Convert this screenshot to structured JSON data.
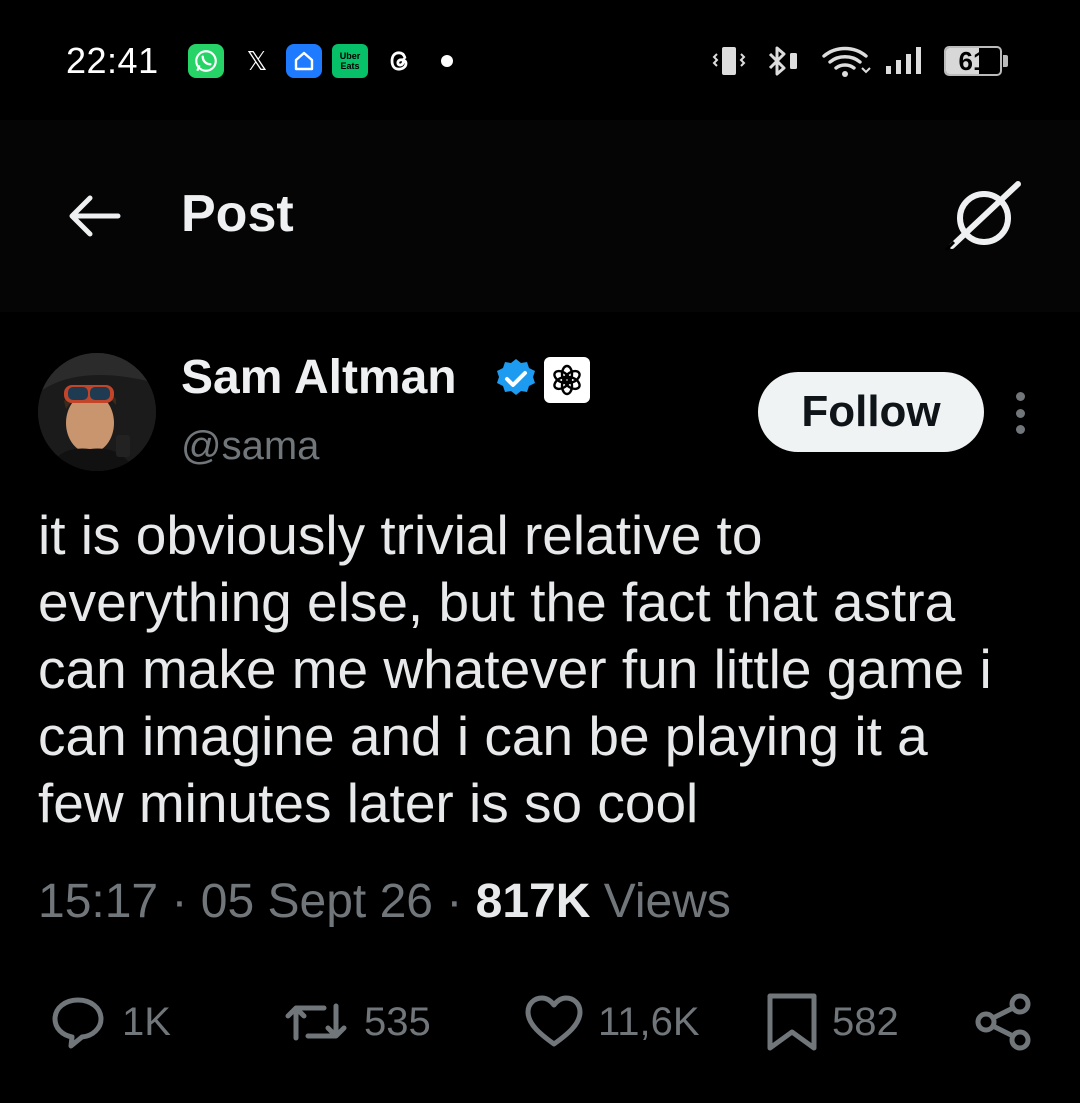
{
  "status_bar": {
    "time": "22:41",
    "battery": "61",
    "battery_level_percent": 61,
    "notification_icons": [
      "whatsapp-icon",
      "x-app-icon",
      "home-app-icon",
      "uber-eats-icon",
      "threads-icon",
      "notification-dot"
    ],
    "uber_eats_label_1": "Uber",
    "uber_eats_label_2": "Eats",
    "x_glyph": "𝕏",
    "system_icons": [
      "vibrate-icon",
      "bluetooth-icon",
      "wifi-icon",
      "signal-icon",
      "battery-icon"
    ]
  },
  "header": {
    "title": "Post",
    "back_icon": "arrow-left-icon",
    "grok_icon": "grok-icon"
  },
  "post": {
    "author_name": "Sam Altman",
    "handle": "@sama",
    "follow_label": "Follow",
    "text": "it is obviously trivial relative to\neverything else, but the fact that astra\ncan make me whatever fun little game i\ncan imagine and i can be playing it a\nfew minutes later is so cool",
    "time": "15:17",
    "sep1": " · ",
    "date": "05 Sept 26",
    "sep2": " · ",
    "views_count": "817K",
    "views_label": " Views"
  },
  "actions": {
    "replies": "1K",
    "reposts": "535",
    "likes": "11,6K",
    "bookmarks": "582"
  },
  "colors": {
    "background": "#000000",
    "text": "#e7e9ea",
    "muted": "#71767b",
    "verified_blue": "#1d9bf0",
    "follow_bg": "#eff3f4"
  }
}
